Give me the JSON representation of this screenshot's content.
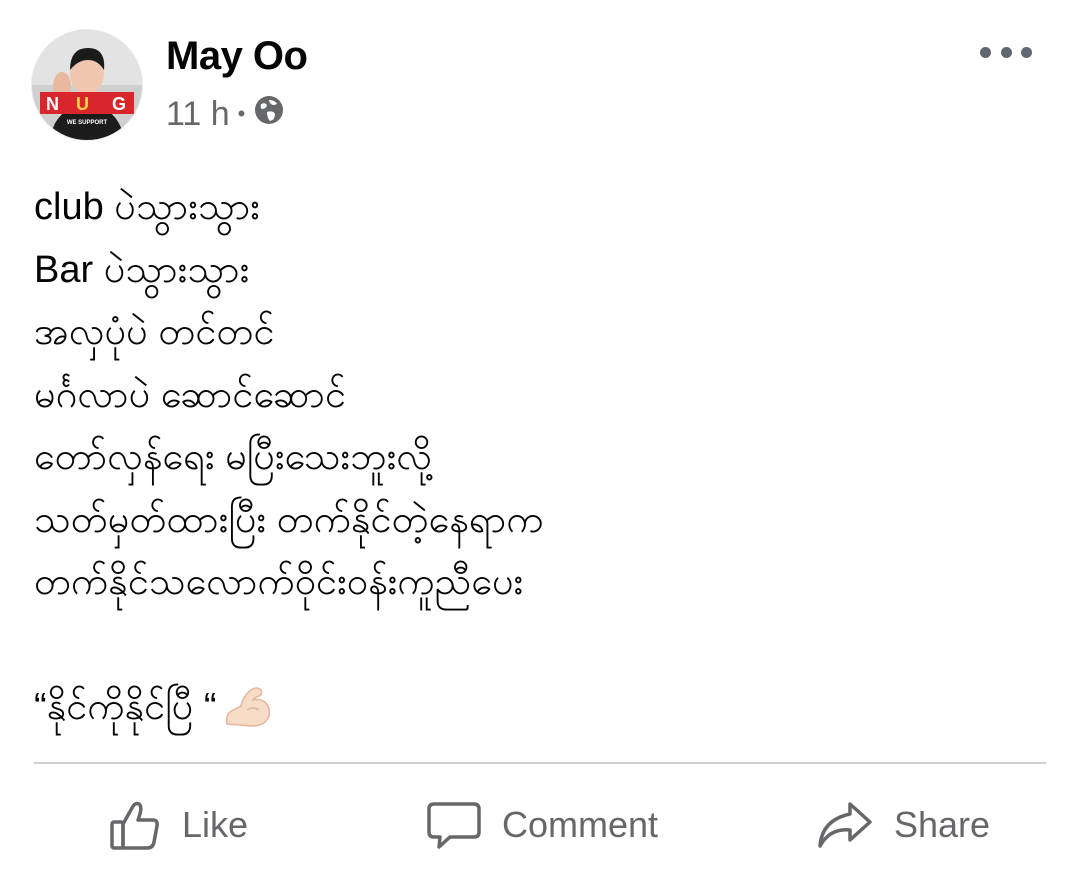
{
  "post": {
    "author": {
      "name": "May Oo",
      "avatar_badge": "NUG",
      "avatar_caption": "WE SUPPORT"
    },
    "meta": {
      "time": "11 h",
      "separator": "•",
      "audience_icon": "globe-icon"
    },
    "more_icon": "more-options-icon",
    "text_lines": [
      "club ပဲသွားသွား",
      "Bar ပဲသွားသွား",
      "အလှပုံပဲ တင်တင်",
      "မင်္ဂလာပဲ ဆောင်ဆောင်",
      "တော်လှန်ရေး မပြီးသေးဘူးလို့",
      "သတ်မှတ်ထားပြီး တက်နိုင်တဲ့နေရာက",
      "တက်နိုင်သလောက်ဝိုင်းဝန်းကူညီပေး"
    ],
    "closing": {
      "text": "“နိုင်ကိုနိုင်ပြီ “",
      "emoji_icon": "flexed-biceps-icon"
    }
  },
  "actions": {
    "like": "Like",
    "comment": "Comment",
    "share": "Share"
  },
  "colors": {
    "text": "#050505",
    "secondary": "#65676b",
    "divider": "#ced0d4"
  }
}
